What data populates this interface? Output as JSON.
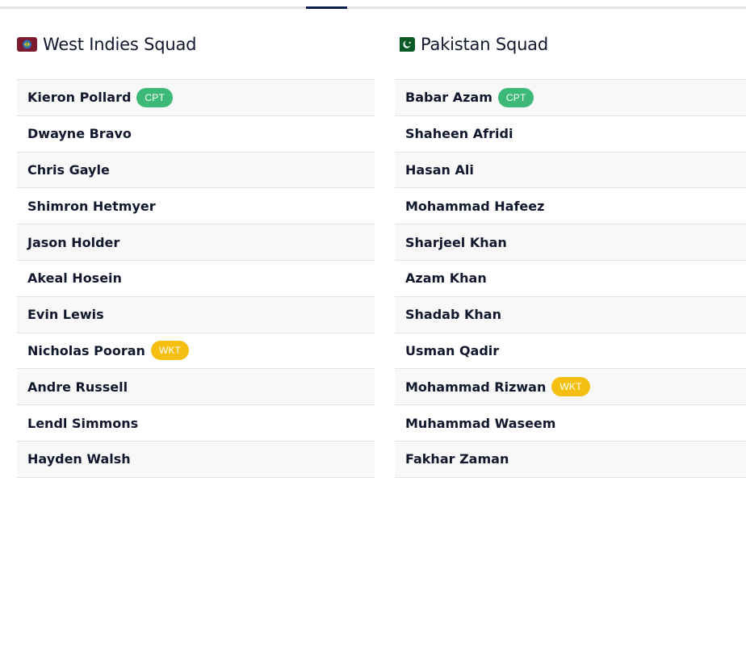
{
  "tabbar": {
    "active_color": "#0c1d4f"
  },
  "squads": [
    {
      "title": "West Indies Squad",
      "flag_icon": "west-indies-flag-icon",
      "players": [
        {
          "name": "Kieron Pollard",
          "badge": "CPT"
        },
        {
          "name": "Dwayne Bravo",
          "badge": ""
        },
        {
          "name": "Chris Gayle",
          "badge": ""
        },
        {
          "name": "Shimron Hetmyer",
          "badge": ""
        },
        {
          "name": "Jason Holder",
          "badge": ""
        },
        {
          "name": "Akeal Hosein",
          "badge": ""
        },
        {
          "name": "Evin Lewis",
          "badge": ""
        },
        {
          "name": "Nicholas Pooran",
          "badge": "WKT"
        },
        {
          "name": "Andre Russell",
          "badge": ""
        },
        {
          "name": "Lendl Simmons",
          "badge": ""
        },
        {
          "name": "Hayden Walsh",
          "badge": ""
        }
      ]
    },
    {
      "title": "Pakistan Squad",
      "flag_icon": "pakistan-flag-icon",
      "players": [
        {
          "name": "Babar Azam",
          "badge": "CPT"
        },
        {
          "name": "Shaheen Afridi",
          "badge": ""
        },
        {
          "name": "Hasan Ali",
          "badge": ""
        },
        {
          "name": "Mohammad Hafeez",
          "badge": ""
        },
        {
          "name": "Sharjeel Khan",
          "badge": ""
        },
        {
          "name": "Azam Khan",
          "badge": ""
        },
        {
          "name": "Shadab Khan",
          "badge": ""
        },
        {
          "name": "Usman Qadir",
          "badge": ""
        },
        {
          "name": "Mohammad Rizwan",
          "badge": "WKT"
        },
        {
          "name": "Muhammad Waseem",
          "badge": ""
        },
        {
          "name": "Fakhar Zaman",
          "badge": ""
        }
      ]
    }
  ],
  "colors": {
    "cpt_badge": "#3cb878",
    "wkt_badge": "#f5bf12",
    "text": "#10182e"
  }
}
